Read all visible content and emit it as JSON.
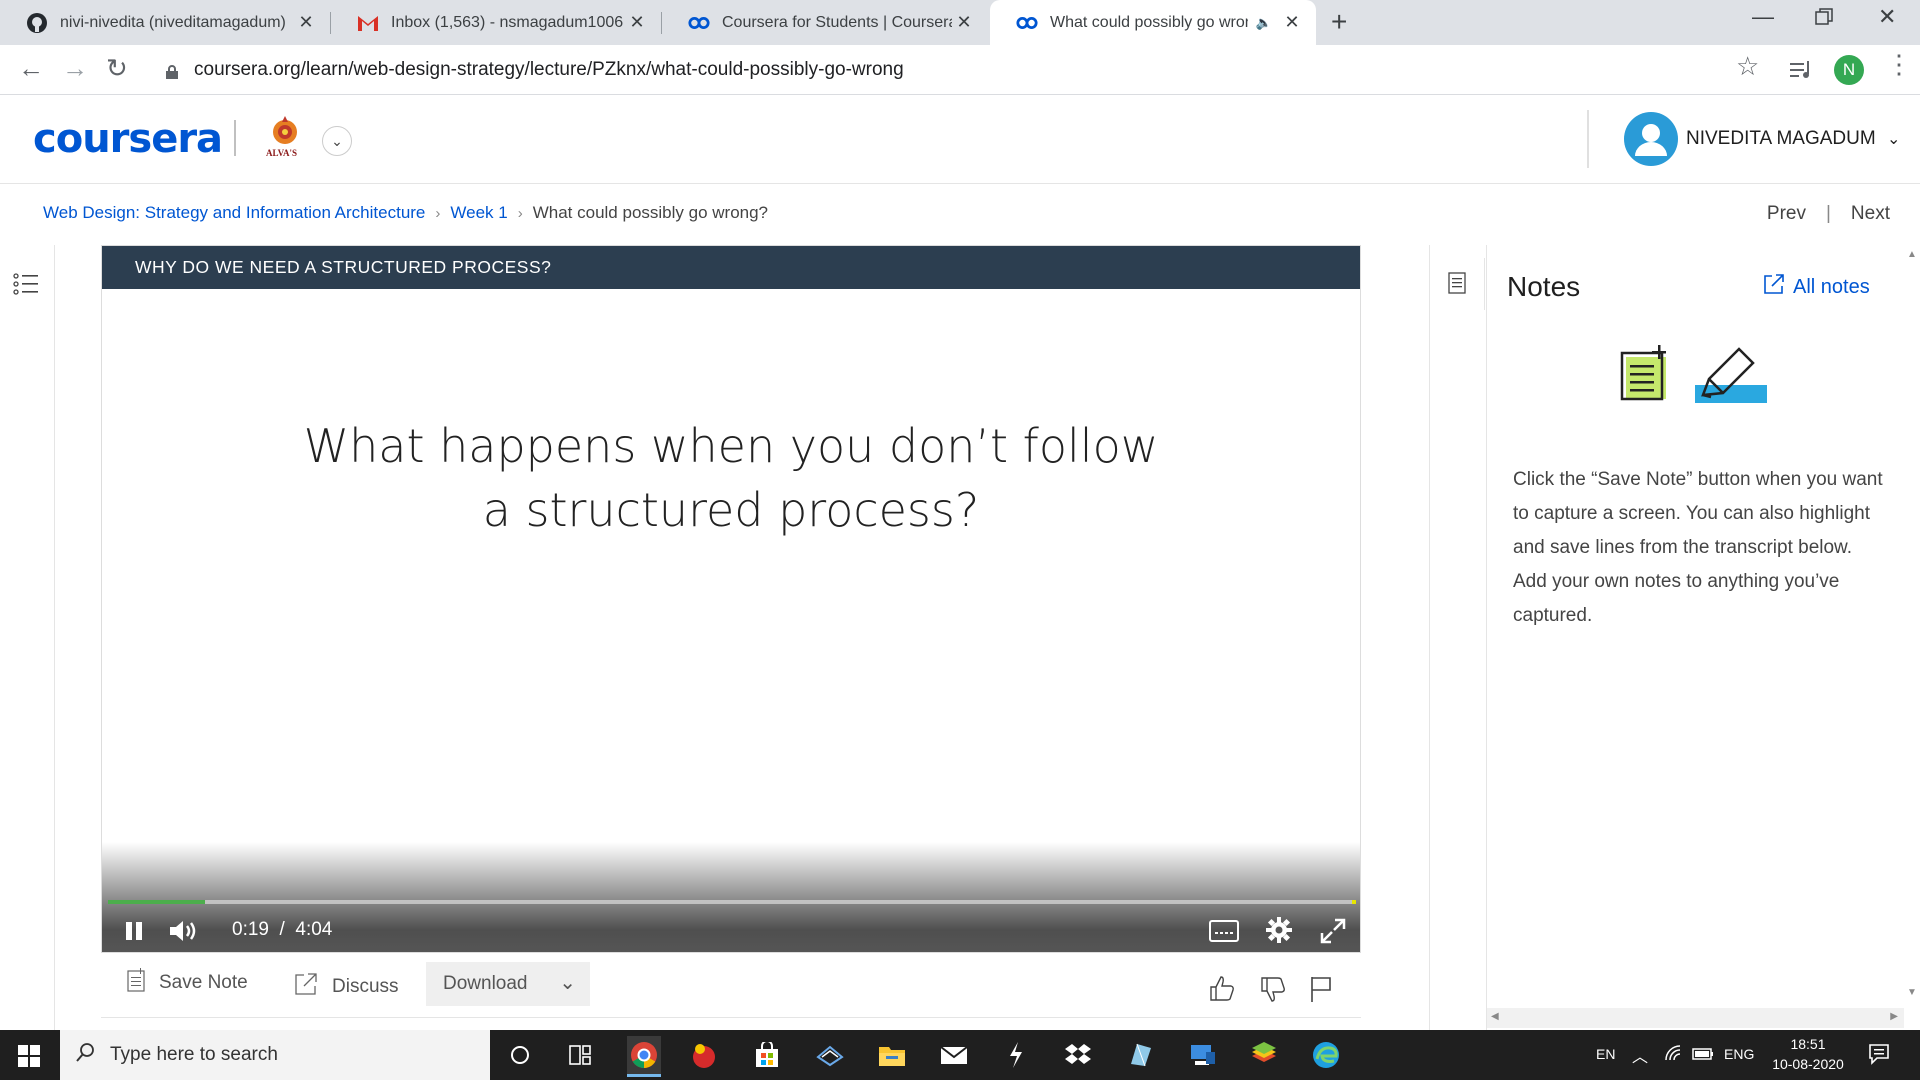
{
  "browser": {
    "tabs": [
      {
        "title": "nivi-nivedita (niveditamagadum)",
        "icon": "github-icon"
      },
      {
        "title": "Inbox (1,563) - nsmagadum1006",
        "icon": "gmail-icon"
      },
      {
        "title": "Coursera for Students | Coursera",
        "icon": "coursera-icon"
      },
      {
        "title": "What could possibly go wrong?",
        "icon": "coursera-icon"
      }
    ],
    "url": "coursera.org/learn/web-design-strategy/lecture/PZknx/what-could-possibly-go-wrong",
    "profile_initial": "N"
  },
  "header": {
    "logo_text": "coursera",
    "institution_label": "ALVA'S",
    "user_name": "NIVEDITA MAGADUM"
  },
  "breadcrumb": {
    "course": "Web Design: Strategy and Information Architecture",
    "week": "Week 1",
    "current": "What could possibly go wrong?"
  },
  "nav": {
    "prev": "Prev",
    "next": "Next"
  },
  "video": {
    "section_title": "WHY DO WE NEED A STRUCTURED PROCESS?",
    "slide_line1": "What happens when you don’t follow",
    "slide_line2": "a structured process?",
    "current_time": "0:19",
    "duration": "4:04",
    "progress_fraction": 0.078
  },
  "actions": {
    "save_note": "Save Note",
    "discuss": "Discuss",
    "download": "Download"
  },
  "notes": {
    "title": "Notes",
    "all_notes": "All notes",
    "description": "Click the “Save Note” button when you want to capture a screen. You can also highlight and save lines from the transcript below. Add your own notes to anything you’ve captured."
  },
  "taskbar": {
    "search_placeholder": "Type here to search",
    "lang1": "EN",
    "lang2": "ENG",
    "time": "18:51",
    "date": "10-08-2020"
  },
  "colors": {
    "accent": "#0056d2",
    "video_title_bg": "#2c3e50",
    "progress": "#4cae4c"
  }
}
